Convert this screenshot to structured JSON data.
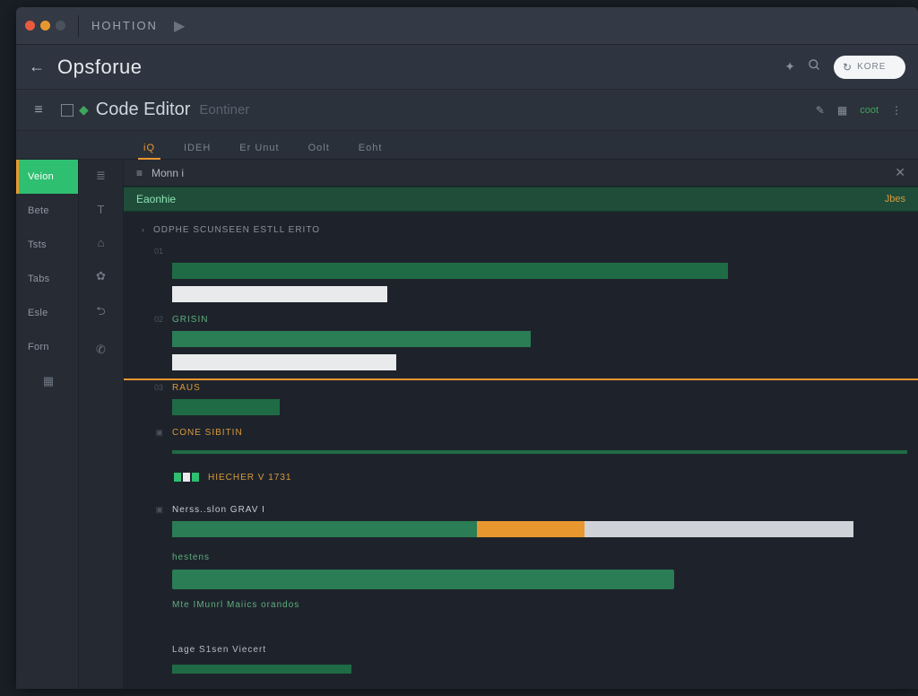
{
  "titlebar": {
    "label": "HOHTION"
  },
  "header": {
    "brand": "Opsforue",
    "search_placeholder": "KORE"
  },
  "subheader": {
    "title": "Code Editor",
    "ghost": "Eontiner",
    "right_text": "coot"
  },
  "tabs": {
    "items": [
      {
        "label": "iQ"
      },
      {
        "label": "IDEH"
      },
      {
        "label": "Er Unut"
      },
      {
        "label": "Oolt"
      },
      {
        "label": "Eoht"
      }
    ]
  },
  "sidebar": {
    "items": [
      {
        "label": "Veion"
      },
      {
        "label": "Bete"
      },
      {
        "label": "Tsts"
      },
      {
        "label": "Tabs"
      },
      {
        "label": "Esle"
      },
      {
        "label": "Forn"
      }
    ]
  },
  "crumb": {
    "left_icon": "≡",
    "label": "Monn i"
  },
  "section": {
    "title": "Eaonhie",
    "right": "Jbes"
  },
  "editor": {
    "heading1": "ODPHE SCUNSEEN ESTLL ERITO",
    "label_green": "GRISIN",
    "label_raus": "RAUS",
    "label_cone": "CONE SIBITIN",
    "label_hiecher": "HIECHER V 1731",
    "label_nerss": "Nerss..slon GRAV I",
    "label_hestens": "hestens",
    "label_mte": "Mte IMunrl Maiics orandos",
    "label_lage": "Lage S1sen Viecert"
  }
}
